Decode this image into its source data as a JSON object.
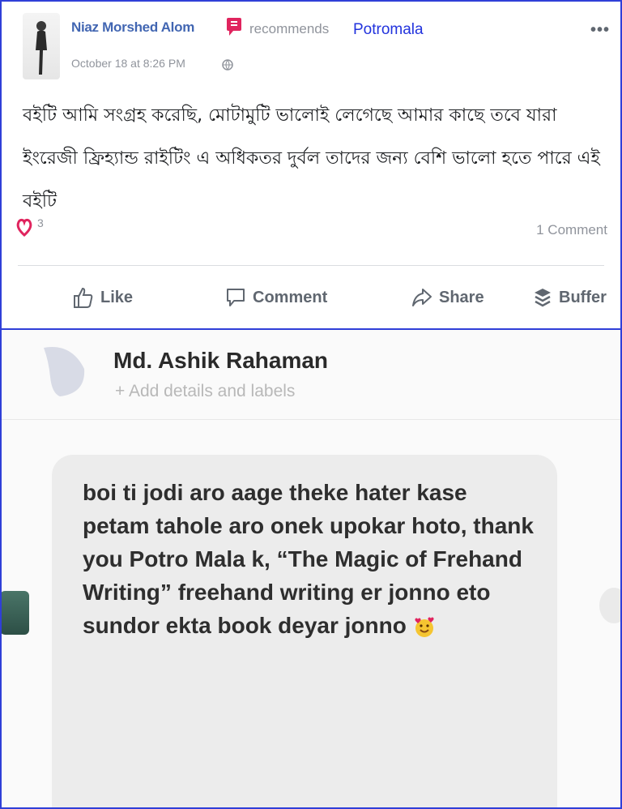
{
  "post": {
    "author": "Niaz Morshed Alom",
    "recommends": "recommends",
    "page_name": "Potromala",
    "timestamp": "October 18 at 8:26 PM",
    "body": "বইটি আমি সংগ্রহ করেছি, মোটামুটি ভালোই লেগেছে আমার কাছে তবে যারা ইংরেজী ফ্রিহ্যান্ড রাইটিং এ অধিকতর দুর্বল তাদের জন্য বেশি ভালো হতে পারে এই বইটি",
    "reaction_count": "3",
    "comment_count": "1 Comment",
    "more": "•••",
    "actions": {
      "like": "Like",
      "comment": "Comment",
      "share": "Share",
      "buffer": "Buffer"
    },
    "accent_color": "#4266b2",
    "heart_color": "#e0245e"
  },
  "messenger": {
    "contact_name": "Md. Ashik Rahaman",
    "add_details": "+ Add details and labels",
    "message": "boi ti jodi aro aage theke hater kase petam tahole aro onek upokar hoto, thank you Potro Mala k, “The Magic of Frehand Writing” freehand writing er jonno eto sundor ekta book deyar jonno",
    "emoji": "smiling-face-with-hearts",
    "bubble_color": "#ececec"
  }
}
